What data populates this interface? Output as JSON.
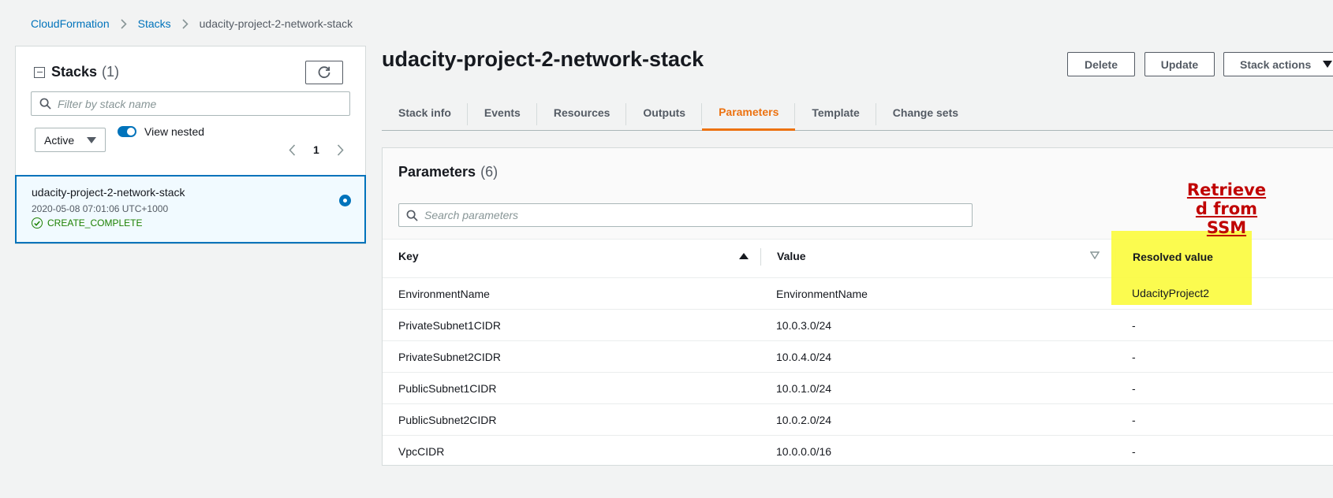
{
  "breadcrumb": {
    "items": [
      "CloudFormation",
      "Stacks"
    ],
    "current": "udacity-project-2-network-stack"
  },
  "stacks_panel": {
    "title": "Stacks",
    "count": "(1)",
    "filter_placeholder": "Filter by stack name",
    "status_filter": "Active",
    "toggle_label": "View nested",
    "page": "1",
    "stack": {
      "name": "udacity-project-2-network-stack",
      "date": "2020-05-08 07:01:06 UTC+1000",
      "status": "CREATE_COMPLETE"
    }
  },
  "main": {
    "title": "udacity-project-2-network-stack",
    "buttons": {
      "delete": "Delete",
      "update": "Update",
      "stack_actions": "Stack actions"
    },
    "tabs": [
      {
        "label": "Stack info"
      },
      {
        "label": "Events"
      },
      {
        "label": "Resources"
      },
      {
        "label": "Outputs"
      },
      {
        "label": "Parameters"
      },
      {
        "label": "Template"
      },
      {
        "label": "Change sets"
      }
    ],
    "active_tab": "Parameters"
  },
  "parameters": {
    "title": "Parameters",
    "count": "(6)",
    "search_placeholder": "Search parameters",
    "columns": {
      "key": "Key",
      "value": "Value",
      "resolved": "Resolved value"
    },
    "rows": [
      {
        "key": "EnvironmentName",
        "value": "EnvironmentName",
        "resolved": "UdacityProject2"
      },
      {
        "key": "PrivateSubnet1CIDR",
        "value": "10.0.3.0/24",
        "resolved": "-"
      },
      {
        "key": "PrivateSubnet2CIDR",
        "value": "10.0.4.0/24",
        "resolved": "-"
      },
      {
        "key": "PublicSubnet1CIDR",
        "value": "10.0.1.0/24",
        "resolved": "-"
      },
      {
        "key": "PublicSubnet2CIDR",
        "value": "10.0.2.0/24",
        "resolved": "-"
      },
      {
        "key": "VpcCIDR",
        "value": "10.0.0.0/16",
        "resolved": "-"
      }
    ]
  },
  "annotation": {
    "line1": "Retrieve",
    "line2": "d from",
    "line3": "SSM",
    "color": "#c00000",
    "highlight_color": "#fbfb46"
  },
  "colors": {
    "link": "#0073bb",
    "active_tab": "#ec7211",
    "success": "#1d8102"
  }
}
